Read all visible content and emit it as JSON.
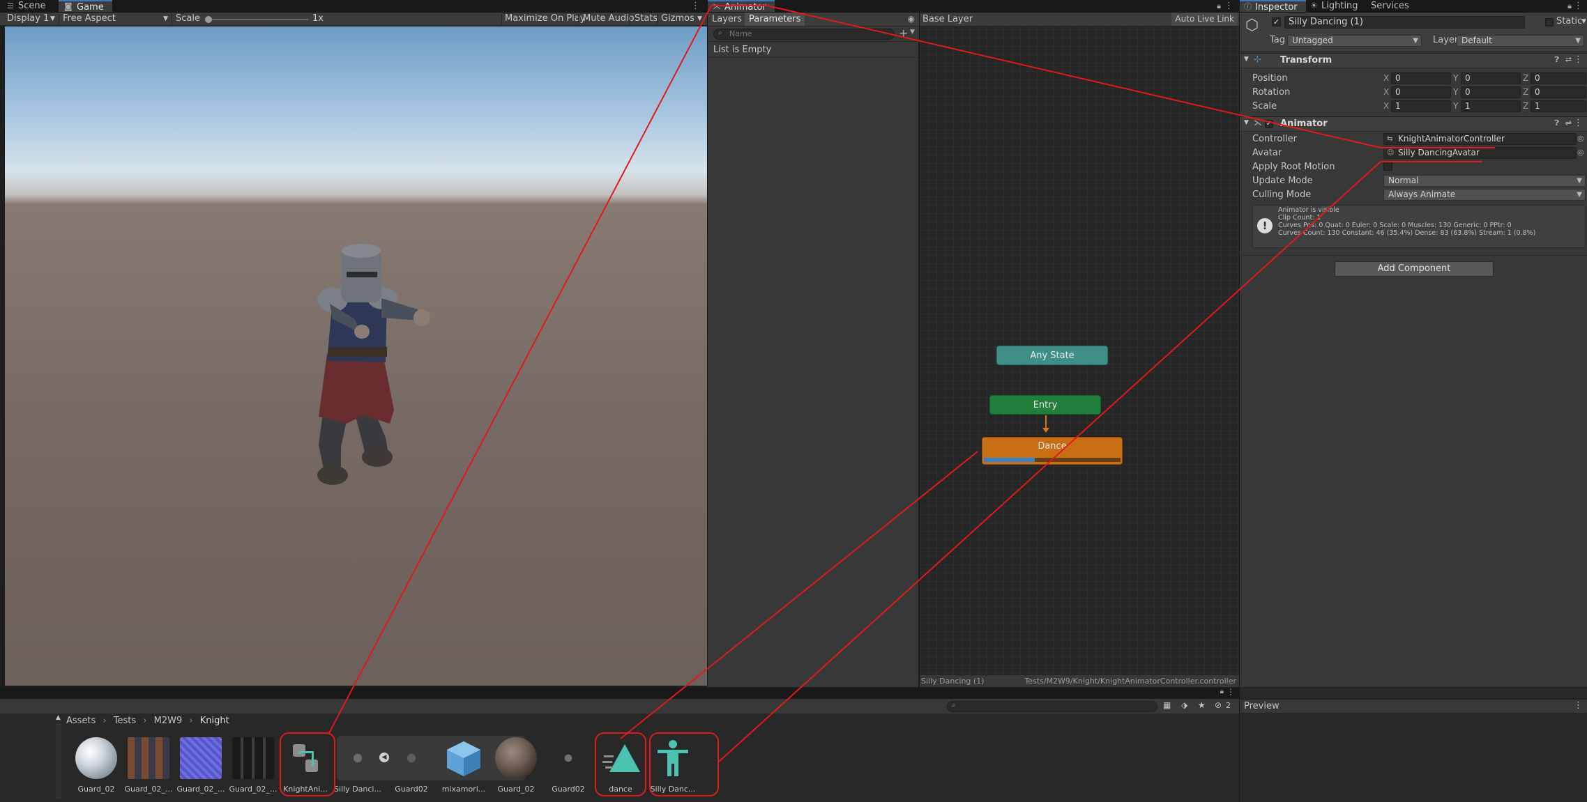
{
  "game_view": {
    "tabs": [
      {
        "label": "Scene"
      },
      {
        "label": "Game"
      }
    ],
    "toolbar": {
      "display": "Display 1",
      "aspect": "Free Aspect",
      "scale_label": "Scale",
      "scale_value": "1x",
      "scale_level": 0,
      "maximize": "Maximize On Play",
      "mute": "Mute Audio",
      "stats": "Stats",
      "gizmos": "Gizmos"
    }
  },
  "animator": {
    "tab": "Animator",
    "subtabs": {
      "layers": "Layers",
      "parameters": "Parameters"
    },
    "search_placeholder": "Name",
    "list_empty": "List is Empty",
    "breadcrumb": "Base Layer",
    "auto_live_link": "Auto Live Link",
    "nodes": {
      "any_state": "Any State",
      "entry": "Entry",
      "dance": "Dance"
    },
    "dance_progress": 0.37,
    "footer_left": "Silly Dancing (1)",
    "footer_right": "Tests/M2W9/Knight/KnightAnimatorController.controller"
  },
  "inspector": {
    "tabs": [
      {
        "label": "Inspector"
      },
      {
        "label": "Lighting"
      },
      {
        "label": "Services"
      }
    ],
    "object_name": "Silly Dancing (1)",
    "static_label": "Static",
    "tag_label": "Tag",
    "tag_value": "Untagged",
    "layer_label": "Layer",
    "layer_value": "Default",
    "transform": {
      "title": "Transform",
      "rows": [
        {
          "label": "Position",
          "x": "0",
          "y": "0",
          "z": "0"
        },
        {
          "label": "Rotation",
          "x": "0",
          "y": "0",
          "z": "0"
        },
        {
          "label": "Scale",
          "x": "1",
          "y": "1",
          "z": "1"
        }
      ],
      "axes": {
        "x": "X",
        "y": "Y",
        "z": "Z"
      }
    },
    "animator_comp": {
      "title": "Animator",
      "controller_label": "Controller",
      "controller_value": "KnightAnimatorController",
      "avatar_label": "Avatar",
      "avatar_value": "Silly DancingAvatar",
      "root_motion_label": "Apply Root Motion",
      "update_mode_label": "Update Mode",
      "update_mode_value": "Normal",
      "culling_mode_label": "Culling Mode",
      "culling_mode_value": "Always Animate",
      "info": [
        "Animator is visible",
        "Clip Count: 1",
        "Curves Pos: 0 Quat: 0 Euler: 0 Scale: 0 Muscles: 130 Generic: 0 PPtr: 0",
        "Curves Count: 130 Constant: 46 (35.4%) Dense: 83 (63.8%) Stream: 1 (0.8%)"
      ]
    },
    "add_component": "Add Component",
    "preview": "Preview"
  },
  "project": {
    "breadcrumb": [
      {
        "label": "Assets"
      },
      {
        "label": "Tests"
      },
      {
        "label": "M2W9"
      },
      {
        "label": "Knight"
      }
    ],
    "hidden_count": "2",
    "assets": [
      {
        "name": "Guard_02"
      },
      {
        "name": "Guard_02_..."
      },
      {
        "name": "Guard_02_..."
      },
      {
        "name": "Guard_02_..."
      },
      {
        "name": "KnightAni..."
      },
      {
        "name": "Silly Danci..."
      },
      {
        "name": "Guard02"
      },
      {
        "name": "mixamori..."
      },
      {
        "name": "Guard_02"
      },
      {
        "name": "Guard02"
      },
      {
        "name": "dance"
      },
      {
        "name": "Silly Danc..."
      }
    ]
  },
  "colors": {
    "accent": "#3a79bb",
    "annotation": "#e0191e",
    "any_state": "#3a8a84",
    "entry": "#1e7b37",
    "dance": "#c86e14"
  }
}
